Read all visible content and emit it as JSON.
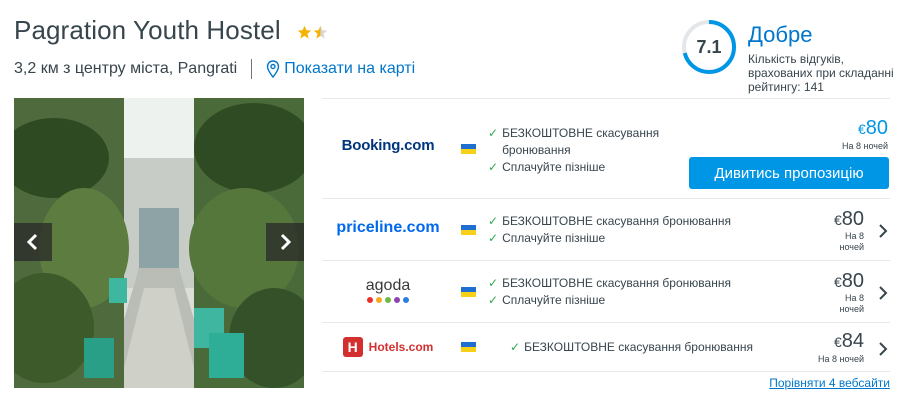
{
  "hotel": {
    "name": "Pagration Youth Hostel",
    "stars": 2,
    "distance": "3,2 км з центру міста, Pangrati",
    "map_link": "Показати на карті"
  },
  "rating": {
    "score": "7.1",
    "fill_fraction": 0.71,
    "word": "Добре",
    "description": "Кількість відгуків, врахованих при складанні рейтингу: 141"
  },
  "gallery": {
    "prev_icon": "chevron-left-icon",
    "next_icon": "chevron-right-icon"
  },
  "offers": [
    {
      "provider": "Booking.com",
      "feature1": "БЕЗКОШТОВНЕ скасування бронювання",
      "feature2": "Сплачуйте пізніше",
      "currency": "€",
      "price": "80",
      "nights": "На 8 ночей",
      "button": "Дивитись пропозицію"
    },
    {
      "provider": "priceline.com",
      "feature1": "БЕЗКОШТОВНЕ скасування бронювання",
      "feature2": "Сплачуйте пізніше",
      "currency": "€",
      "price": "80",
      "nights": "На 8 ночей"
    },
    {
      "provider": "agoda",
      "feature1": "БЕЗКОШТОВНЕ скасування бронювання",
      "feature2": "Сплачуйте пізніше",
      "currency": "€",
      "price": "80",
      "nights": "На 8 ночей"
    },
    {
      "provider": "Hotels.com",
      "feature1": "БЕЗКОШТОВНЕ скасування бронювання",
      "currency": "€",
      "price": "84",
      "nights": "На 8 ночей"
    }
  ],
  "compare_link": "Порівняти 4 вебсайти",
  "colors": {
    "accent": "#0077cc",
    "button": "#0096e6",
    "star": "#f5b301",
    "check": "#32a852",
    "booking_blue": "#003580",
    "booking_light": "#009fe3",
    "priceline": "#0068ef",
    "hotels_red": "#d32f2f"
  }
}
